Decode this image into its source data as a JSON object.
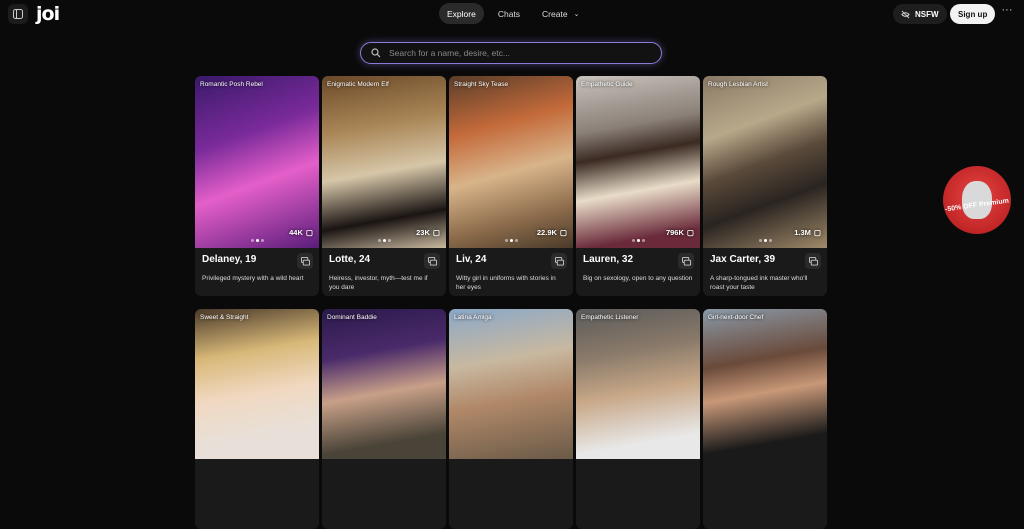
{
  "header": {
    "logo": "joi",
    "nav": [
      {
        "label": "Explore",
        "active": true
      },
      {
        "label": "Chats",
        "active": false
      },
      {
        "label": "Create",
        "active": false
      }
    ],
    "nsfw_label": "NSFW",
    "signup_label": "Sign up",
    "more_label": "···"
  },
  "search": {
    "placeholder": "Search for a name, desire, etc..."
  },
  "promo": {
    "label": "-50% OFF Premium"
  },
  "cards": [
    {
      "tag": "Romantic Posh Rebel",
      "count": "44K",
      "name": "Delaney, 19",
      "desc": "Privileged mystery with a wild heart"
    },
    {
      "tag": "Enigmatic Modern Elf",
      "count": "23K",
      "name": "Lotte, 24",
      "desc": "Heiress, investor, myth—test me if you dare"
    },
    {
      "tag": "Straight Sky Tease",
      "count": "22.9K",
      "name": "Liv, 24",
      "desc": "Witty girl in uniforms with stories in her eyes"
    },
    {
      "tag": "Empathetic Guide",
      "count": "796K",
      "name": "Lauren, 32",
      "desc": "Big on sexology, open to any question"
    },
    {
      "tag": "Rough Lesbian Artist",
      "count": "1.3M",
      "name": "Jax Carter, 39",
      "desc": "A sharp-tongued ink master who'll roast your taste"
    }
  ],
  "cards_row2": [
    {
      "tag": "Sweet & Straight"
    },
    {
      "tag": "Dominant Baddie"
    },
    {
      "tag": "Latina Amiga"
    },
    {
      "tag": "Empathetic Listener"
    },
    {
      "tag": "Girl-next-door Chef"
    }
  ]
}
